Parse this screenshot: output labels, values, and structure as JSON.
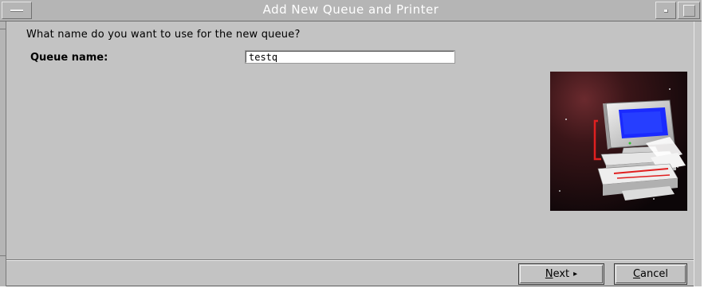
{
  "window": {
    "title": "Add New Queue and Printer"
  },
  "form": {
    "question": "What name do you want to use for the new queue?",
    "queue_name_label": "Queue name:",
    "queue_name_value": "testq"
  },
  "illustration": {
    "icon": "computer-printer-illustration"
  },
  "buttons": {
    "next": {
      "mnemonic": "N",
      "rest": "ext",
      "arrow": "▸"
    },
    "cancel": {
      "mnemonic": "C",
      "rest": "ancel"
    }
  },
  "colors": {
    "window_bg": "#c3c3c3",
    "titlebar_bg": "#b5b5b5",
    "title_text": "#ffffff",
    "monitor_screen": "#1a2aff",
    "accent_red": "#e02020"
  }
}
